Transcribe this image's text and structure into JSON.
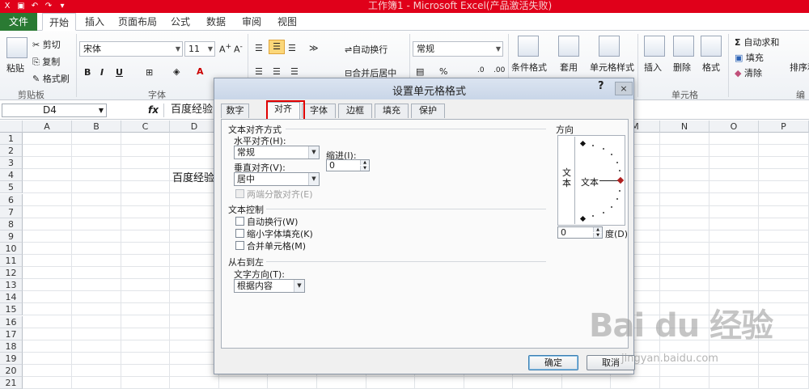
{
  "window": {
    "title": "工作簿1 - Microsoft Excel(产品激活失败)"
  },
  "ribbon": {
    "tabs": [
      "文件",
      "开始",
      "插入",
      "页面布局",
      "公式",
      "数据",
      "审阅",
      "视图"
    ],
    "clipboard": {
      "paste": "粘贴",
      "cut": "剪切",
      "copy": "复制",
      "format_painter": "格式刷",
      "label": "剪贴板"
    },
    "font": {
      "name": "宋体",
      "size": "11",
      "label": "字体",
      "bold": "B",
      "italic": "I",
      "underline": "U"
    },
    "alignment": {
      "wrap": "自动换行",
      "merge": "合并后居中"
    },
    "number": {
      "format": "常规",
      "percent": "%"
    },
    "styles": {
      "conditional": "条件格式",
      "table": "套用",
      "table2": "表格格式",
      "cell_styles": "单元格样式"
    },
    "cells": {
      "insert": "插入",
      "delete": "删除",
      "format": "格式",
      "label": "单元格"
    },
    "editing": {
      "autosum": "自动求和",
      "fill": "填充",
      "clear": "清除",
      "sort": "排序和",
      "label": "编辑"
    }
  },
  "formula_bar": {
    "name_box": "D4",
    "fx": "fx",
    "value": "百度经验"
  },
  "sheet": {
    "columns": [
      "A",
      "B",
      "C",
      "D",
      "E",
      "F",
      "G",
      "H",
      "I",
      "J",
      "K",
      "L",
      "M",
      "N",
      "O",
      "P"
    ],
    "rows": [
      "1",
      "2",
      "3",
      "4",
      "5",
      "6",
      "7",
      "8",
      "9",
      "10",
      "11",
      "12",
      "13",
      "14",
      "15",
      "16",
      "17",
      "18",
      "19",
      "20",
      "21"
    ],
    "cell_d4": "百度经验"
  },
  "dialog": {
    "title": "设置单元格格式",
    "help": "?",
    "close": "×",
    "tabs": [
      "数字",
      "对齐",
      "字体",
      "边框",
      "填充",
      "保护"
    ],
    "active_tab": "对齐",
    "text_alignment": {
      "section": "文本对齐方式",
      "horizontal_label": "水平对齐(H):",
      "horizontal_value": "常规",
      "indent_label": "缩进(I):",
      "indent_value": "0",
      "vertical_label": "垂直对齐(V):",
      "vertical_value": "居中",
      "justify_distributed": "两端分散对齐(E)"
    },
    "text_control": {
      "section": "文本控制",
      "wrap": "自动换行(W)",
      "shrink": "缩小字体填充(K)",
      "merge": "合并单元格(M)"
    },
    "rtl": {
      "section": "从右到左",
      "direction_label": "文字方向(T):",
      "direction_value": "根据内容"
    },
    "orientation": {
      "section": "方向",
      "vertical_text": "文本",
      "horizontal_text": "文本",
      "degrees_value": "0",
      "degrees_label": "度(D)"
    },
    "ok": "确定",
    "cancel": "取消"
  },
  "watermark": {
    "brand": "Bai du 经验",
    "url": "jingyan.baidu.com"
  }
}
